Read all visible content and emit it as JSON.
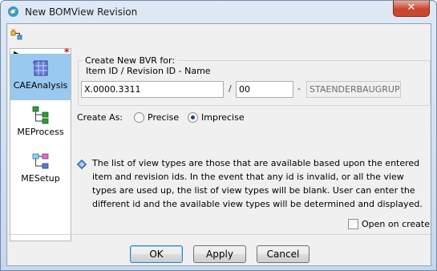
{
  "window": {
    "title": "New BOMView Revision",
    "close_glyph": "✕"
  },
  "toolbar": {
    "icon": "new-object-icon"
  },
  "sidebar": {
    "items": [
      {
        "label": "CAEAnalysis",
        "icon": "cae-analysis-icon",
        "selected": true
      },
      {
        "label": "MEProcess",
        "icon": "me-process-icon",
        "selected": false
      },
      {
        "label": "MESetup",
        "icon": "me-setup-icon",
        "selected": false
      }
    ],
    "required_marker": "*"
  },
  "form": {
    "group_title": "Create New BVR for:",
    "header_text": "Item ID  /  Revision ID  -  Name",
    "item_id": "X.0000.3311",
    "separator": "/",
    "revision_id": "00",
    "dash": "-",
    "name": "STAENDERBAUGRUP",
    "create_as_label": "Create As:",
    "precise_label": "Precise",
    "imprecise_label": "Imprecise",
    "selected_mode": "Imprecise",
    "info_text": "The list of view types are those that are available based upon the entered item and revision ids. In the event that any id is invalid, or all the view types are used up, the list of view types will be blank. User can enter the different id and the available view types will be determined and displayed.",
    "open_on_create_label": "Open on create",
    "open_on_create_checked": false
  },
  "buttons": {
    "ok": "OK",
    "apply": "Apply",
    "cancel": "Cancel"
  },
  "colors": {
    "selection": "#99c9ef",
    "close": "#c8462d"
  }
}
